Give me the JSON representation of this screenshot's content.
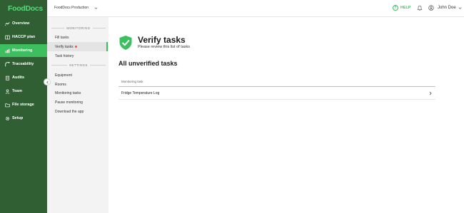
{
  "brand": {
    "logo": "FoodDocs",
    "accent": "#3dbf5f",
    "sidebar_bg": "#2f5f33"
  },
  "sidebar": {
    "items": [
      {
        "label": "Overview",
        "icon": "overview-icon",
        "active": false
      },
      {
        "label": "HACCP plan",
        "icon": "book-icon",
        "active": false
      },
      {
        "label": "Monitoring",
        "icon": "chart-icon",
        "active": true
      },
      {
        "label": "Traceability",
        "icon": "traceability-icon",
        "active": false
      },
      {
        "label": "Audits",
        "icon": "clipboard-icon",
        "active": false
      },
      {
        "label": "Team",
        "icon": "person-icon",
        "active": false
      },
      {
        "label": "File storage",
        "icon": "folder-icon",
        "active": false
      },
      {
        "label": "Setup",
        "icon": "gear-icon",
        "active": false
      }
    ]
  },
  "subnav": {
    "monitoring_heading": "MONITORING",
    "monitoring_items": [
      {
        "label": "Fill tasks"
      },
      {
        "label": "Verify tasks",
        "active": true,
        "has_alert": true
      },
      {
        "label": "Task history"
      }
    ],
    "settings_heading": "SETTINGS",
    "settings_items": [
      {
        "label": "Equipment"
      },
      {
        "label": "Rooms"
      },
      {
        "label": "Monitoring tasks"
      },
      {
        "label": "Pause monitoring"
      },
      {
        "label": "Download the app"
      }
    ]
  },
  "topbar": {
    "organization": "FoodDocs Production",
    "help_label": "HELP",
    "user_name": "John Doe"
  },
  "main": {
    "title": "Verify tasks",
    "subtitle": "Please review this list of tasks",
    "section_title": "All unverified tasks",
    "table": {
      "columns": [
        "Monitoring task"
      ],
      "rows": [
        {
          "task": "Fridge Temperature Log"
        }
      ]
    }
  }
}
